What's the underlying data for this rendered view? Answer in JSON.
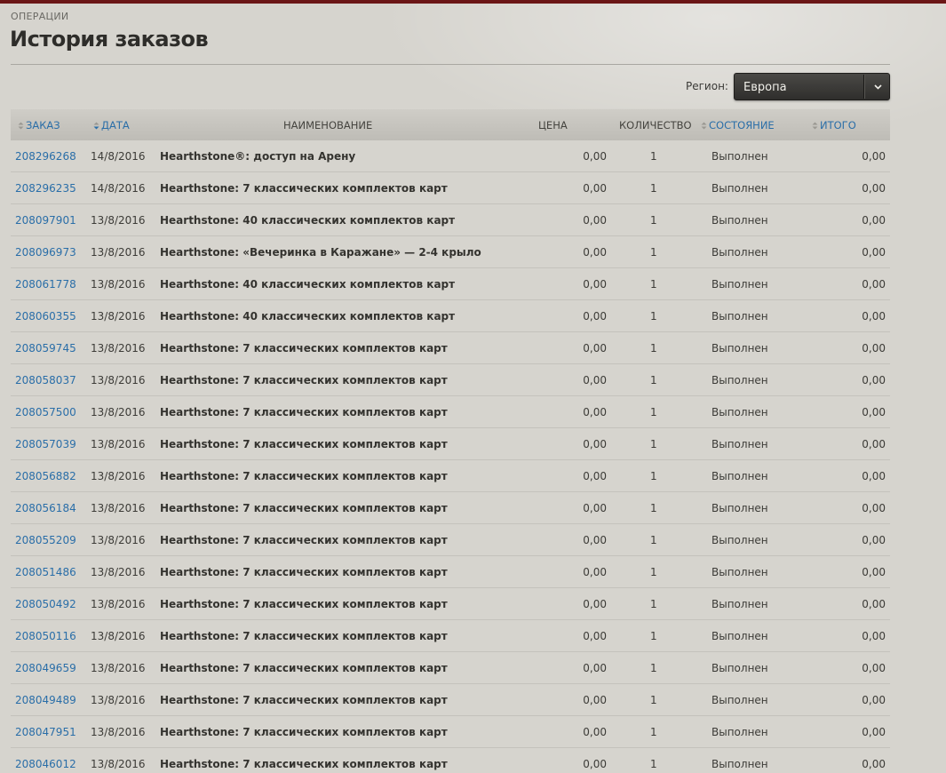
{
  "breadcrumb": "ОПЕРАЦИИ",
  "title": "История заказов",
  "region": {
    "label": "Регион:",
    "selected": "Европа"
  },
  "table": {
    "columns": {
      "order": "ЗАКАЗ",
      "date": "ДАТА",
      "name": "НАИМЕНОВАНИЕ",
      "price": "ЦЕНА",
      "qty": "КОЛИЧЕСТВО",
      "status": "СОСТОЯНИЕ",
      "total": "ИТОГО"
    },
    "rows": [
      {
        "order": "208296268",
        "date": "14/8/2016",
        "name": "Hearthstone®: доступ на Арену",
        "price": "0,00",
        "qty": "1",
        "status": "Выполнен",
        "total": "0,00"
      },
      {
        "order": "208296235",
        "date": "14/8/2016",
        "name": "Hearthstone: 7 классических комплектов карт",
        "price": "0,00",
        "qty": "1",
        "status": "Выполнен",
        "total": "0,00"
      },
      {
        "order": "208097901",
        "date": "13/8/2016",
        "name": "Hearthstone: 40 классических комплектов карт",
        "price": "0,00",
        "qty": "1",
        "status": "Выполнен",
        "total": "0,00"
      },
      {
        "order": "208096973",
        "date": "13/8/2016",
        "name": "Hearthstone: «Вечеринка в Каражане» — 2-4 крыло",
        "price": "0,00",
        "qty": "1",
        "status": "Выполнен",
        "total": "0,00"
      },
      {
        "order": "208061778",
        "date": "13/8/2016",
        "name": "Hearthstone: 40 классических комплектов карт",
        "price": "0,00",
        "qty": "1",
        "status": "Выполнен",
        "total": "0,00"
      },
      {
        "order": "208060355",
        "date": "13/8/2016",
        "name": "Hearthstone: 40 классических комплектов карт",
        "price": "0,00",
        "qty": "1",
        "status": "Выполнен",
        "total": "0,00"
      },
      {
        "order": "208059745",
        "date": "13/8/2016",
        "name": "Hearthstone: 7 классических комплектов карт",
        "price": "0,00",
        "qty": "1",
        "status": "Выполнен",
        "total": "0,00"
      },
      {
        "order": "208058037",
        "date": "13/8/2016",
        "name": "Hearthstone: 7 классических комплектов карт",
        "price": "0,00",
        "qty": "1",
        "status": "Выполнен",
        "total": "0,00"
      },
      {
        "order": "208057500",
        "date": "13/8/2016",
        "name": "Hearthstone: 7 классических комплектов карт",
        "price": "0,00",
        "qty": "1",
        "status": "Выполнен",
        "total": "0,00"
      },
      {
        "order": "208057039",
        "date": "13/8/2016",
        "name": "Hearthstone: 7 классических комплектов карт",
        "price": "0,00",
        "qty": "1",
        "status": "Выполнен",
        "total": "0,00"
      },
      {
        "order": "208056882",
        "date": "13/8/2016",
        "name": "Hearthstone: 7 классических комплектов карт",
        "price": "0,00",
        "qty": "1",
        "status": "Выполнен",
        "total": "0,00"
      },
      {
        "order": "208056184",
        "date": "13/8/2016",
        "name": "Hearthstone: 7 классических комплектов карт",
        "price": "0,00",
        "qty": "1",
        "status": "Выполнен",
        "total": "0,00"
      },
      {
        "order": "208055209",
        "date": "13/8/2016",
        "name": "Hearthstone: 7 классических комплектов карт",
        "price": "0,00",
        "qty": "1",
        "status": "Выполнен",
        "total": "0,00"
      },
      {
        "order": "208051486",
        "date": "13/8/2016",
        "name": "Hearthstone: 7 классических комплектов карт",
        "price": "0,00",
        "qty": "1",
        "status": "Выполнен",
        "total": "0,00"
      },
      {
        "order": "208050492",
        "date": "13/8/2016",
        "name": "Hearthstone: 7 классических комплектов карт",
        "price": "0,00",
        "qty": "1",
        "status": "Выполнен",
        "total": "0,00"
      },
      {
        "order": "208050116",
        "date": "13/8/2016",
        "name": "Hearthstone: 7 классических комплектов карт",
        "price": "0,00",
        "qty": "1",
        "status": "Выполнен",
        "total": "0,00"
      },
      {
        "order": "208049659",
        "date": "13/8/2016",
        "name": "Hearthstone: 7 классических комплектов карт",
        "price": "0,00",
        "qty": "1",
        "status": "Выполнен",
        "total": "0,00"
      },
      {
        "order": "208049489",
        "date": "13/8/2016",
        "name": "Hearthstone: 7 классических комплектов карт",
        "price": "0,00",
        "qty": "1",
        "status": "Выполнен",
        "total": "0,00"
      },
      {
        "order": "208047951",
        "date": "13/8/2016",
        "name": "Hearthstone: 7 классических комплектов карт",
        "price": "0,00",
        "qty": "1",
        "status": "Выполнен",
        "total": "0,00"
      },
      {
        "order": "208046012",
        "date": "13/8/2016",
        "name": "Hearthstone: 7 классических комплектов карт",
        "price": "0,00",
        "qty": "1",
        "status": "Выполнен",
        "total": "0,00"
      }
    ]
  },
  "colors": {
    "link": "#2a6ea8",
    "background": "#d6d4ce",
    "top_strip": "#6b1616"
  },
  "icons": {
    "sort": "sort-arrows-icon",
    "dropdown": "chevron-down-icon"
  }
}
